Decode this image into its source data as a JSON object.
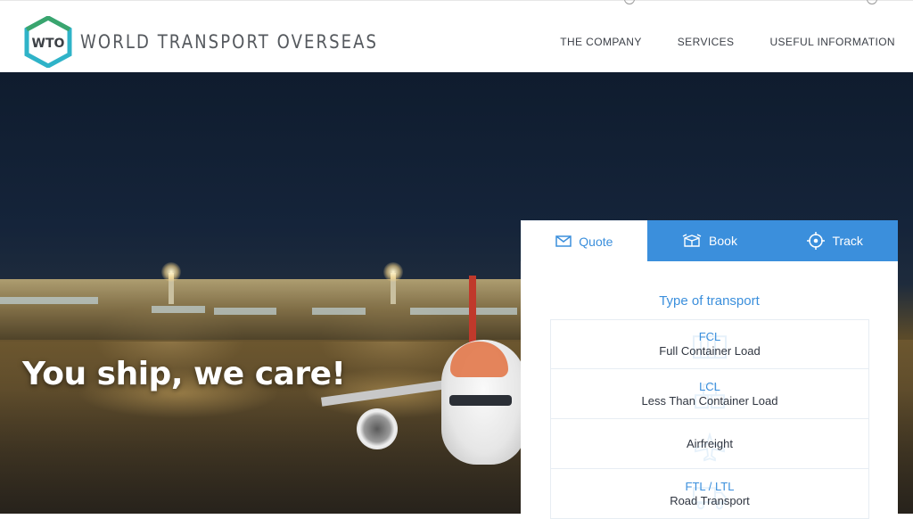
{
  "header": {
    "logo_text": "WTO",
    "brand": "WORLD TRANSPORT OVERSEAS",
    "nav": [
      {
        "label": "THE COMPANY"
      },
      {
        "label": "SERVICES"
      },
      {
        "label": "USEFUL INFORMATION"
      }
    ]
  },
  "hero": {
    "tagline": "You ship, we care!"
  },
  "booking": {
    "tabs": [
      {
        "label": "Quote",
        "icon": "envelope-icon",
        "active": true
      },
      {
        "label": "Book",
        "icon": "box-icon",
        "active": false
      },
      {
        "label": "Track",
        "icon": "target-icon",
        "active": false
      }
    ],
    "type_heading": "Type of transport",
    "options": [
      {
        "code": "FCL",
        "desc": "Full Container Load"
      },
      {
        "code": "LCL",
        "desc": "Less Than Container Load"
      },
      {
        "code": "",
        "desc": "Airfreight"
      },
      {
        "code": "FTL / LTL",
        "desc": "Road Transport"
      }
    ]
  },
  "colors": {
    "accent": "#3b8fdc",
    "logo_teal": "#2fb3c8",
    "text_dark": "#2f3540"
  }
}
